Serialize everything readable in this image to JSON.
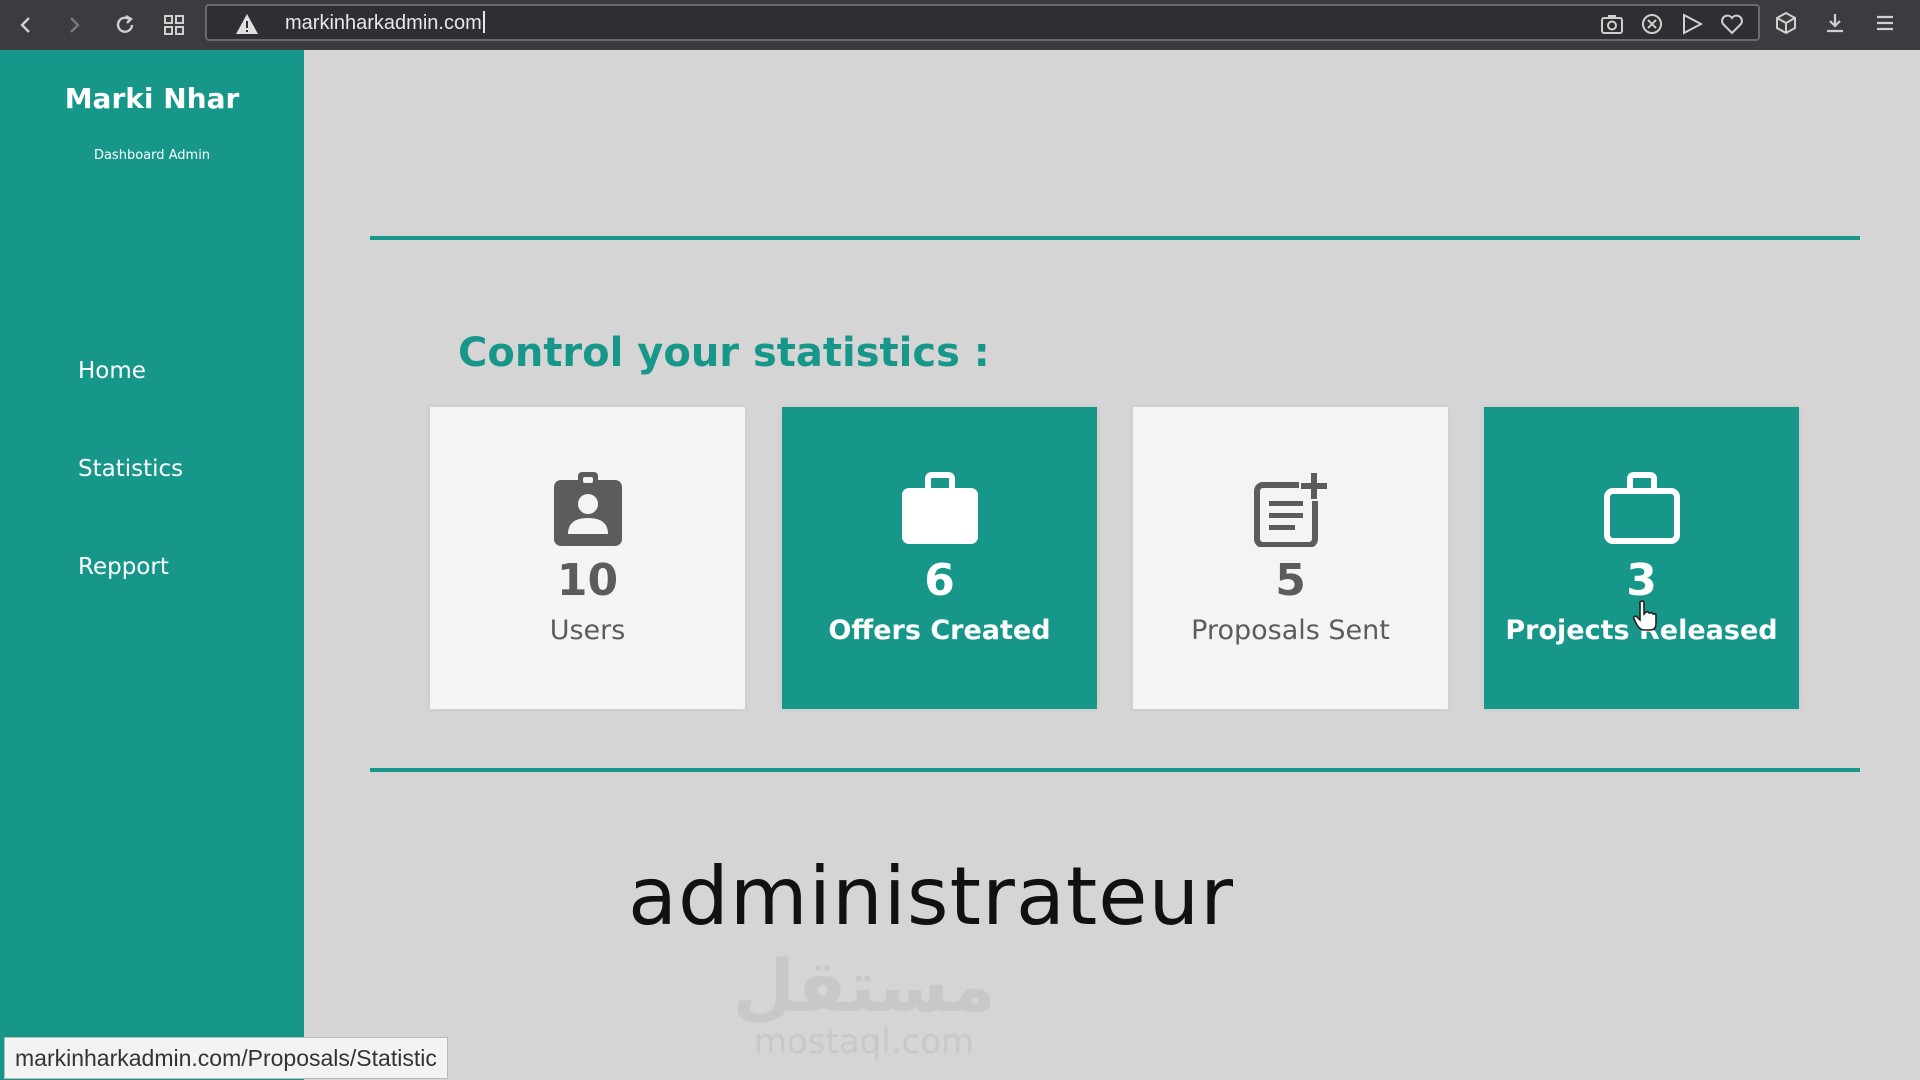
{
  "browser": {
    "url": "markinharkadmin.com",
    "status_url": "markinharkadmin.com/Proposals/Statistic",
    "icons": [
      "back-icon",
      "forward-icon",
      "reload-icon",
      "tabs-grid-icon",
      "warning-icon",
      "camera-icon",
      "block-icon",
      "send-icon",
      "heart-icon",
      "cube-icon",
      "download-icon",
      "menu-icon"
    ]
  },
  "sidebar": {
    "brand": "Marki Nhar",
    "subtitle": "Dashboard Admin",
    "items": [
      {
        "label": "Home"
      },
      {
        "label": "Statistics"
      },
      {
        "label": "Repport"
      }
    ]
  },
  "main": {
    "title": "Control your statistics :",
    "cards": [
      {
        "value": "10",
        "label": "Users",
        "icon": "user-badge-icon",
        "style": "light"
      },
      {
        "value": "6",
        "label": "Offers Created",
        "icon": "briefcase-icon",
        "style": "teal"
      },
      {
        "value": "5",
        "label": "Proposals Sent",
        "icon": "document-add-icon",
        "style": "light"
      },
      {
        "value": "3",
        "label": "Projects Released",
        "icon": "briefcase-outline-icon",
        "style": "teal"
      }
    ]
  },
  "overlay": {
    "caption": "administrateur",
    "watermark_arabic": "مستقل",
    "watermark_latin": "mostaql.com"
  },
  "colors": {
    "accent": "#16978a",
    "background": "#d5d5d5",
    "card_light": "#f4f4f4",
    "chrome": "#3b3c40"
  }
}
